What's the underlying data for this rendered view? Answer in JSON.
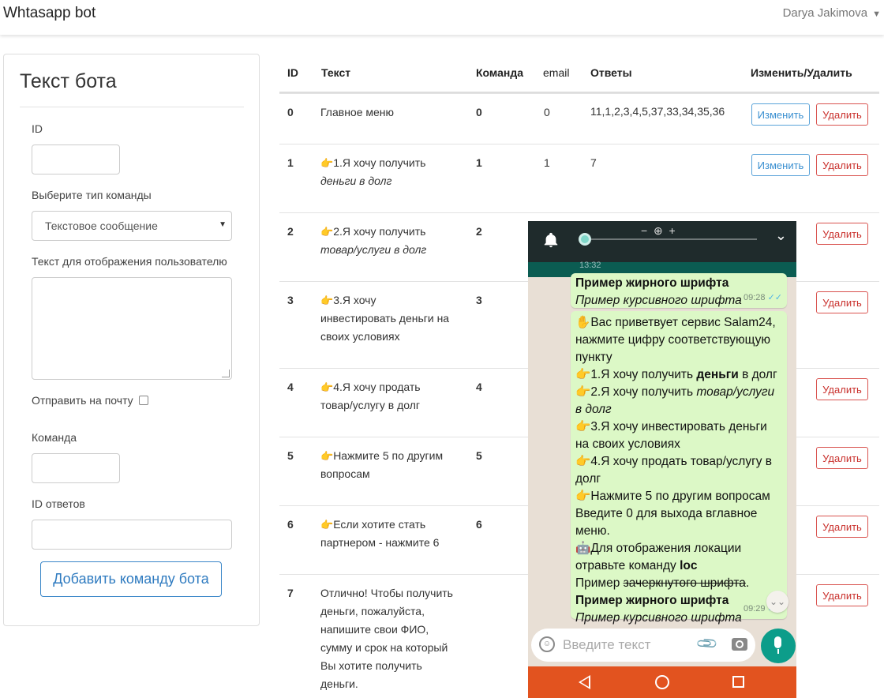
{
  "navbar": {
    "brand": "Whtasapp bot",
    "user": "Darya Jakimova",
    "user_caret": "▼"
  },
  "form": {
    "title": "Текст бота",
    "id_label": "ID",
    "type_label": "Выберите тип команды",
    "type_value": "Текстовое сообщение",
    "text_label": "Текст для отображения пользователю",
    "email_label": "Отправить на почту",
    "command_label": "Команда",
    "answers_label": "ID ответов",
    "submit": "Добавить команду бота"
  },
  "table": {
    "headers": [
      "ID",
      "Текст",
      "Команда",
      "email",
      "Ответы",
      "Изменить/Удалить"
    ],
    "edit_label": "Изменить",
    "delete_label": "Удалить",
    "rows": [
      {
        "id": "0",
        "text1": "Главное меню",
        "text2": "",
        "command": "0",
        "email": "0",
        "answers": "11,1,2,3,4,5,37,33,34,35,36"
      },
      {
        "id": "1",
        "text1": "1.Я хочу получить",
        "text2": "деньги в долг",
        "command": "1",
        "email": "1",
        "answers": "7"
      },
      {
        "id": "2",
        "text1": "2.Я хочу получить",
        "text2": "товар/услуги в долг",
        "command": "2",
        "email": "",
        "answers": ""
      },
      {
        "id": "3",
        "text1": "3.Я хочу",
        "text2": "инвестировать деньги на",
        "text3": "своих условиях",
        "command": "3",
        "email": "",
        "answers": ""
      },
      {
        "id": "4",
        "text1": "4.Я хочу продать",
        "text2": "товар/услугу в долг",
        "command": "4",
        "email": "",
        "answers": ""
      },
      {
        "id": "5",
        "text1": "Нажмите 5 по другим",
        "text2": "вопросам",
        "command": "5",
        "email": "",
        "answers": ""
      },
      {
        "id": "6",
        "text1": "Если хотите стать",
        "text2": "партнером - нажмите 6",
        "command": "6",
        "email": "",
        "answers": ""
      },
      {
        "id": "7",
        "lines": [
          "Отлично! Чтобы получить",
          "деньги, пожалуйста,",
          "напишите свои ФИО,",
          "сумму и срок на который",
          "Вы хотите получить",
          "деньги."
        ],
        "command": "",
        "email": "",
        "answers": ""
      }
    ]
  },
  "phone": {
    "time_partial": "13:32",
    "zoom_minus": "−",
    "zoom_plus": "+",
    "bubble1": {
      "line1": "Пример жирного шрифта",
      "line2": "Пример курсивного шрифта",
      "time": "09:28"
    },
    "bubble2": {
      "greeting": "Вас приветвует сервис Salam24, нажмите цифру соответствующую пункту",
      "item1_pre": "1.Я хочу получить ",
      "item1_bold": "деньги",
      "item1_post": " в долг",
      "item2_pre": "2.Я хочу получить ",
      "item2_italic": "товар/услуги в долг",
      "item3": "3.Я хочу инвестировать деньги на своих условиях",
      "item4": "4.Я хочу продать товар/услугу в долг",
      "item5": "Нажмите 5 по другим вопросам",
      "exit": "Введите 0 для выхода вглавное меню.",
      "loc_pre": "Для отображения локации отравьте команду ",
      "loc_bold": "loc",
      "strike_pre": "Пример ",
      "strike_text": "зачеркнутого шрифта",
      "strike_post": ".",
      "bold_line": "Пример жирного шрифта",
      "italic_line": "Пример курсивного шрифта",
      "time": "09:29"
    },
    "input_placeholder": "Введите текст"
  }
}
